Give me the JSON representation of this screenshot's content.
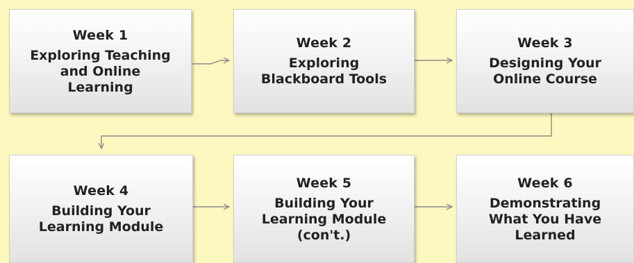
{
  "colors": {
    "background": "#fdf7c0",
    "box_text": "#222222",
    "connector": "#8a8a8a"
  },
  "weeks": [
    {
      "week": "Week 1",
      "topic": "Exploring Teaching\nand Online\nLearning"
    },
    {
      "week": "Week 2",
      "topic": "Exploring\nBlackboard Tools"
    },
    {
      "week": "Week 3",
      "topic": "Designing Your\nOnline Course"
    },
    {
      "week": "Week 4",
      "topic": "Building Your\nLearning Module"
    },
    {
      "week": "Week 5",
      "topic": "Building Your\nLearning Module\n(con't.)"
    },
    {
      "week": "Week 6",
      "topic": "Demonstrating\nWhat You Have\nLearned"
    }
  ]
}
